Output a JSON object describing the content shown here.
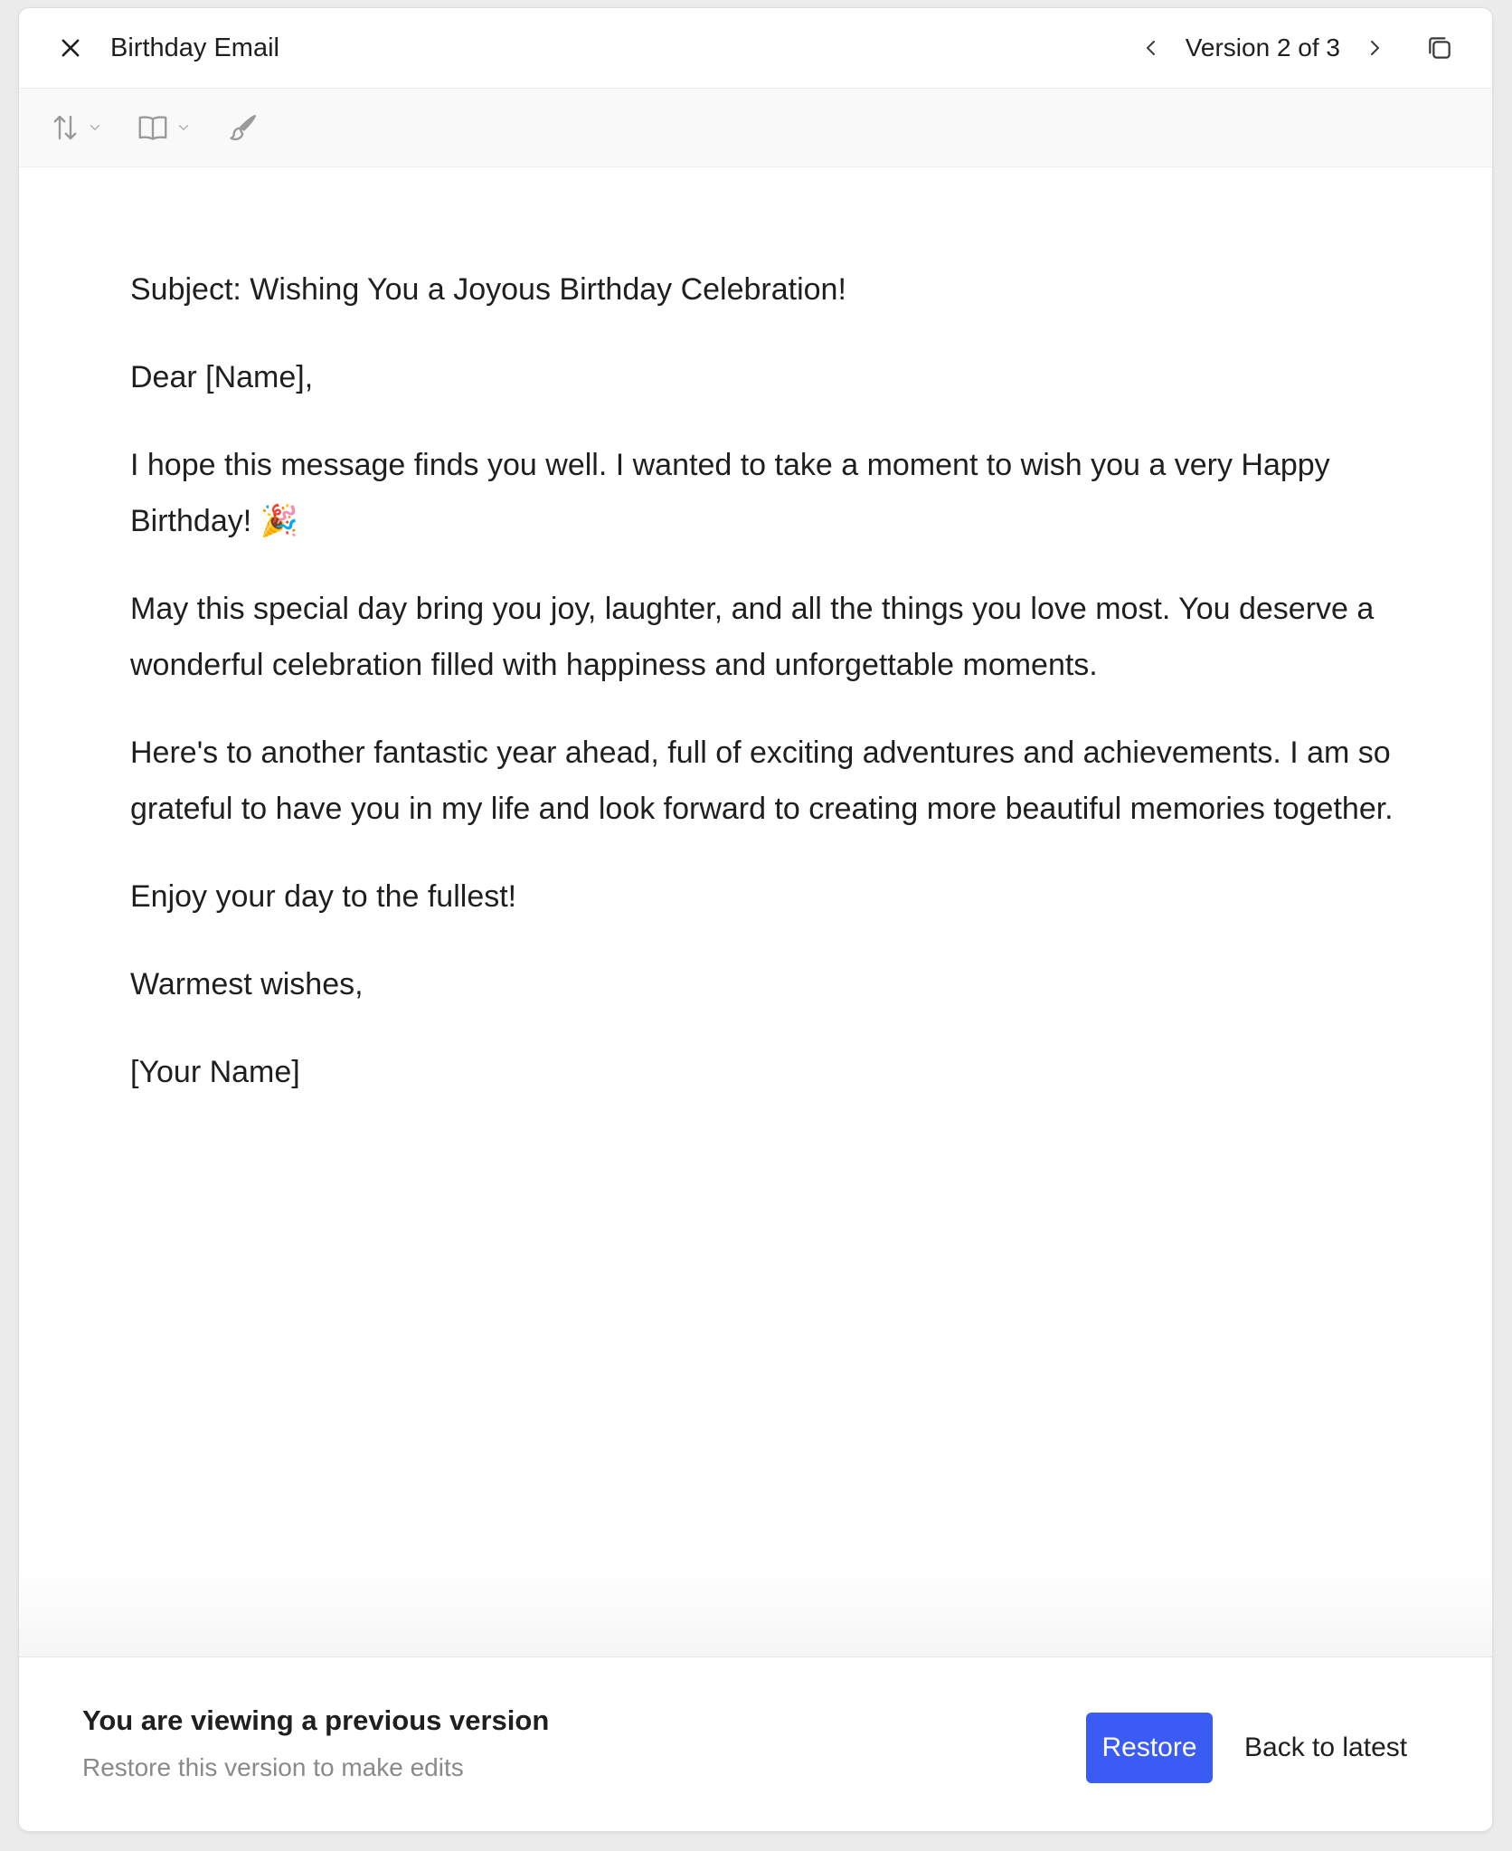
{
  "header": {
    "title": "Birthday Email",
    "version_label": "Version 2 of 3"
  },
  "toolbar": {
    "tools": [
      "arrows-up-down-icon",
      "book-icon",
      "brush-icon"
    ]
  },
  "document": {
    "subject": "Subject: Wishing You a Joyous Birthday Celebration!",
    "greeting": "Dear [Name],",
    "para1": "I hope this message finds you well. I wanted to take a moment to wish you a very Happy Birthday! 🎉",
    "para2": "May this special day bring you joy, laughter, and all the things you love most. You deserve a wonderful celebration filled with happiness and unforgettable moments.",
    "para3": "Here's to another fantastic year ahead, full of exciting adventures and achievements. I am so grateful to have you in my life and look forward to creating more beautiful memories together.",
    "closing_line": "Enjoy your day to the fullest!",
    "signoff": "Warmest wishes,",
    "signature": "[Your Name]"
  },
  "footer": {
    "heading": "You are viewing a previous version",
    "subtext": "Restore this version to make edits",
    "restore_label": "Restore",
    "back_label": "Back to latest"
  },
  "colors": {
    "accent": "#3b5bf5",
    "muted_text": "#8a8a8a",
    "icon_gray": "#9a9a9a"
  }
}
